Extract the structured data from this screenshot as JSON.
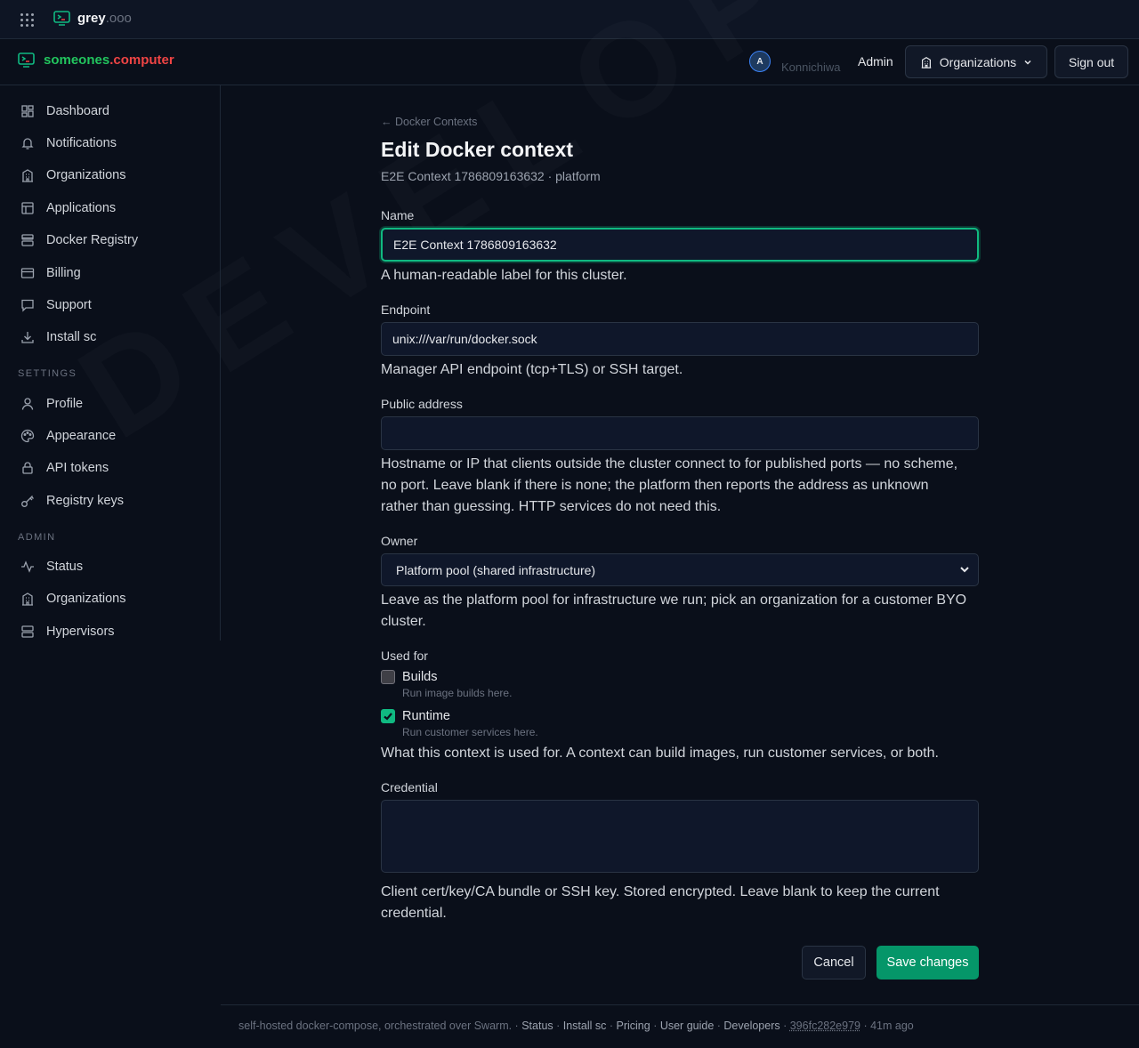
{
  "topbar": {
    "brand_name": "grey",
    "brand_suffix": ".ooo"
  },
  "header": {
    "brand_green": "someones",
    "brand_red": ".computer",
    "avatar_initial": "A",
    "greeting": "Konnichiwa",
    "user_role": "Admin",
    "org_button": "Organizations",
    "signout_button": "Sign out"
  },
  "sidebar": {
    "items": [
      {
        "label": "Dashboard",
        "icon": "dashboard-icon"
      },
      {
        "label": "Notifications",
        "icon": "bell-icon"
      },
      {
        "label": "Organizations",
        "icon": "building-icon"
      },
      {
        "label": "Applications",
        "icon": "layout-icon"
      },
      {
        "label": "Docker Registry",
        "icon": "server-icon"
      },
      {
        "label": "Billing",
        "icon": "card-icon"
      },
      {
        "label": "Support",
        "icon": "chat-icon"
      },
      {
        "label": "Install sc",
        "icon": "download-icon"
      }
    ],
    "settings_label": "SETTINGS",
    "settings_items": [
      {
        "label": "Profile",
        "icon": "user-icon"
      },
      {
        "label": "Appearance",
        "icon": "palette-icon"
      },
      {
        "label": "API tokens",
        "icon": "lock-icon"
      },
      {
        "label": "Registry keys",
        "icon": "key-icon"
      }
    ],
    "admin_label": "ADMIN",
    "admin_items": [
      {
        "label": "Status",
        "icon": "activity-icon"
      },
      {
        "label": "Organizations",
        "icon": "building-icon"
      },
      {
        "label": "Hypervisors",
        "icon": "server-icon"
      }
    ]
  },
  "watermark": "DEVELOPMENT",
  "page": {
    "back_link": "← Docker Contexts",
    "title": "Edit Docker context",
    "subtitle": "E2E Context 1786809163632 · platform"
  },
  "form": {
    "name_label": "Name",
    "name_value": "E2E Context 1786809163632",
    "name_help": "A human-readable label for this cluster.",
    "endpoint_label": "Endpoint",
    "endpoint_value": "unix:///var/run/docker.sock",
    "endpoint_help": "Manager API endpoint (tcp+TLS) or SSH target.",
    "public_label": "Public address",
    "public_value": "",
    "public_help_1": "Hostname or IP that clients outside the cluster connect to for published ports — no scheme,",
    "public_help_2": "no port. Leave blank if there is none; the platform then reports the address as unknown",
    "public_help_3": "rather than guessing. HTTP services do not need this.",
    "owner_label": "Owner",
    "owner_value": "Platform pool (shared infrastructure)",
    "owner_help_1": "Leave as the platform pool for infrastructure we run; pick an organization for a customer BYO",
    "owner_help_2": "cluster.",
    "used_for_label": "Used for",
    "builds_label": "Builds",
    "builds_sub": "Run image builds here.",
    "builds_checked": false,
    "runtime_label": "Runtime",
    "runtime_sub": "Run customer services here.",
    "runtime_checked": true,
    "used_for_help": "What this context is used for. A context can build images, run customer services, or both.",
    "credential_label": "Credential",
    "credential_help_1": "Client cert/key/CA bundle or SSH key. Stored encrypted. Leave blank to keep the current",
    "credential_help_2": "credential.",
    "cancel": "Cancel",
    "save": "Save changes"
  },
  "footer": {
    "tagline": "self-hosted docker-compose, orchestrated over Swarm. ·",
    "links": [
      "Status",
      "Install sc",
      "Pricing",
      "User guide",
      "Developers"
    ],
    "hash": "396fc282e979",
    "age": "· 41m ago"
  },
  "colors": {
    "accent": "#10b981",
    "save_bg": "#059669",
    "brand_green": "#22c55e",
    "brand_red": "#ef4444"
  }
}
